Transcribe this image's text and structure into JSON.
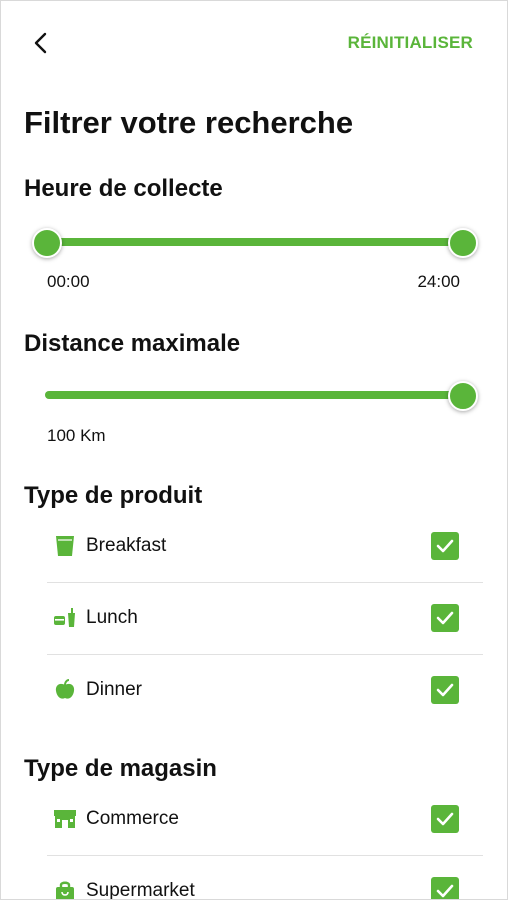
{
  "header": {
    "reset_label": "RÉINITIALISER"
  },
  "page": {
    "title": "Filtrer votre recherche"
  },
  "pickup_time": {
    "title": "Heure de collecte",
    "min_label": "00:00",
    "max_label": "24:00",
    "range_start_fraction": 0.0,
    "range_end_fraction": 1.0
  },
  "distance": {
    "title": "Distance maximale",
    "value_label": "100 Km",
    "value_fraction": 1.0
  },
  "product_type": {
    "title": "Type de produit",
    "items": [
      {
        "label": "Breakfast",
        "icon": "cup-icon",
        "checked": true
      },
      {
        "label": "Lunch",
        "icon": "lunch-icon",
        "checked": true
      },
      {
        "label": "Dinner",
        "icon": "apple-icon",
        "checked": true
      }
    ]
  },
  "store_type": {
    "title": "Type de magasin",
    "items": [
      {
        "label": "Commerce",
        "icon": "storefront-icon",
        "checked": true
      },
      {
        "label": "Supermarket",
        "icon": "shopping-bag-icon",
        "checked": true
      }
    ]
  },
  "colors": {
    "accent": "#5ab53a",
    "text": "#111111",
    "divider": "#e1e1e1"
  }
}
